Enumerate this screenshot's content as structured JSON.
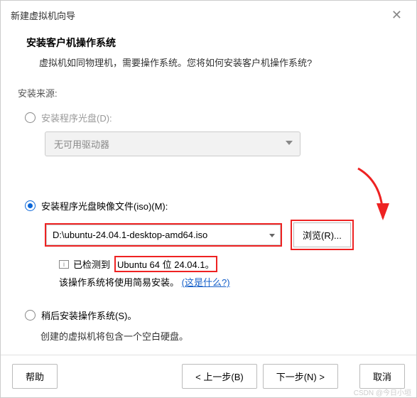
{
  "titlebar": {
    "title": "新建虚拟机向导"
  },
  "header": {
    "h1": "安装客户机操作系统",
    "sub": "虚拟机如同物理机，需要操作系统。您将如何安装客户机操作系统?"
  },
  "source_label": "安装来源:",
  "option_disc": {
    "label": "安装程序光盘(D):",
    "dropdown": "无可用驱动器"
  },
  "option_iso": {
    "label": "安装程序光盘映像文件(iso)(M):",
    "path": "D:\\ubuntu-24.04.1-desktop-amd64.iso",
    "browse": "浏览(R)...",
    "detected_prefix": "已检测到",
    "detected_os": "Ubuntu 64 位 24.04.1。",
    "easy_install": "该操作系统将使用简易安装。",
    "what_is": "(这是什么?)"
  },
  "option_later": {
    "label": "稍后安装操作系统(S)。",
    "note": "创建的虚拟机将包含一个空白硬盘。"
  },
  "footer": {
    "help": "帮助",
    "back": "< 上一步(B)",
    "next": "下一步(N) >",
    "cancel": "取消"
  },
  "watermark": "CSDN @今日小垣"
}
